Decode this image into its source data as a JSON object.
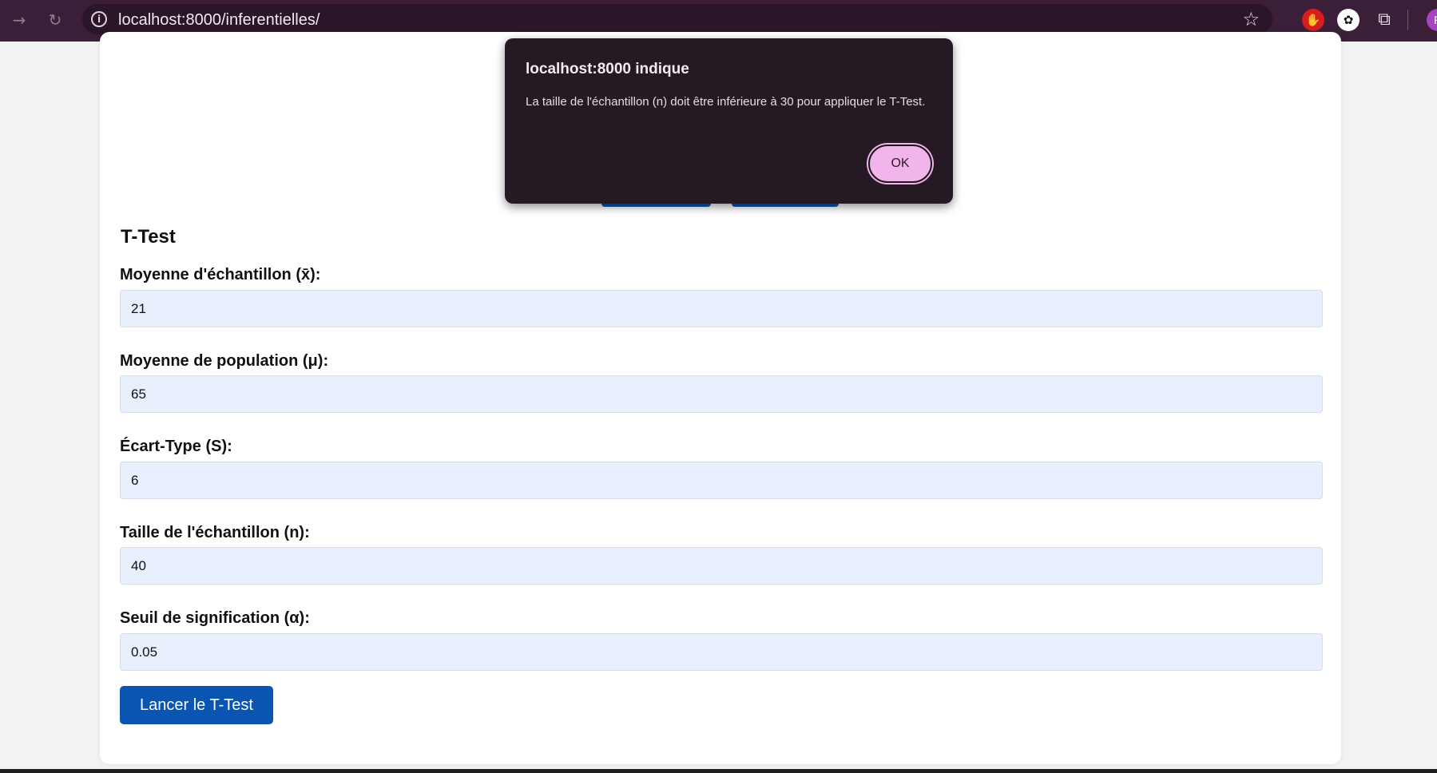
{
  "browser": {
    "url": "localhost:8000/inferentielles/",
    "profile_initial": "R"
  },
  "page": {
    "heading": "T-Test",
    "fields": [
      {
        "label": "Moyenne d'échantillon (x̄):",
        "value": "21"
      },
      {
        "label": "Moyenne de population (μ):",
        "value": "65"
      },
      {
        "label": "Écart-Type (S):",
        "value": "6"
      },
      {
        "label": "Taille de l'échantillon (n):",
        "value": "40"
      },
      {
        "label": "Seuil de signification (α):",
        "value": "0.05"
      }
    ],
    "run_button": "Lancer le T-Test"
  },
  "dialog": {
    "title": "localhost:8000 indique",
    "message": "La taille de l'échantillon (n) doit être inférieure à 30 pour appliquer le T-Test.",
    "ok_label": "OK"
  },
  "colors": {
    "accent": "#0b55b2",
    "input_bg": "#e8effd",
    "dialog_bg": "#251a23",
    "ok_button": "#f2b5eb",
    "browser_bar": "#3b1f38"
  }
}
